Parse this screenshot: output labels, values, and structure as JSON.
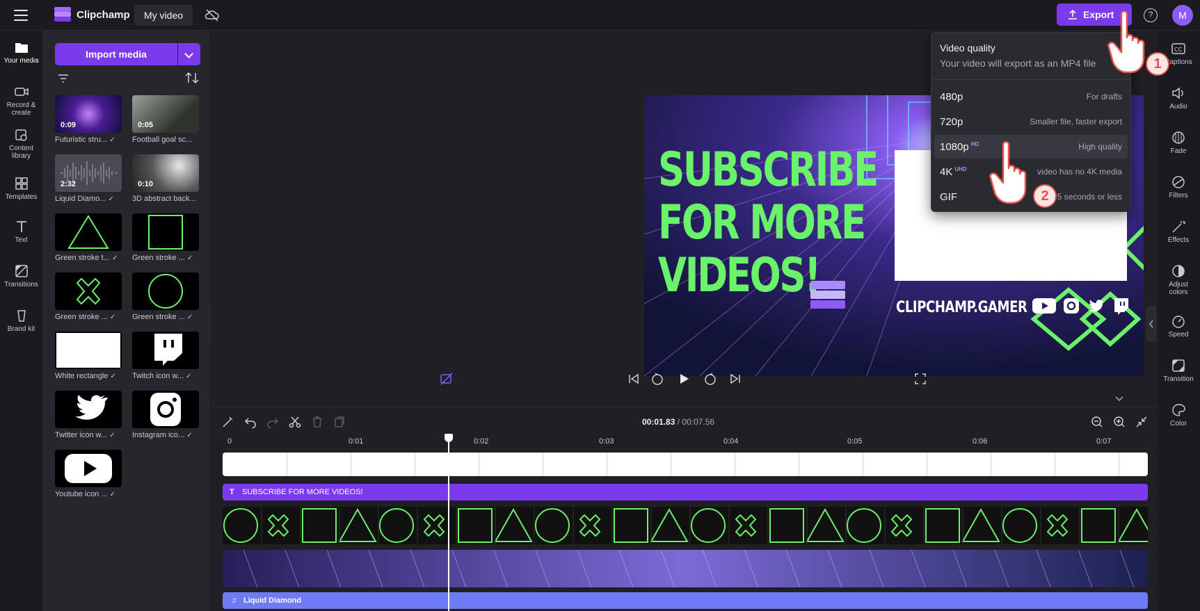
{
  "topbar": {
    "app_name": "Clipchamp",
    "project_name": "My video",
    "export_label": "Export",
    "avatar_initial": "M"
  },
  "left_rail": {
    "items": [
      {
        "label": "Your media",
        "icon": "folder-icon"
      },
      {
        "label": "Record & create",
        "icon": "camera-icon"
      },
      {
        "label": "Content library",
        "icon": "library-icon"
      },
      {
        "label": "Templates",
        "icon": "templates-icon"
      },
      {
        "label": "Text",
        "icon": "text-icon"
      },
      {
        "label": "Transitions",
        "icon": "transitions-icon"
      },
      {
        "label": "Brand kit",
        "icon": "brand-kit-icon"
      }
    ]
  },
  "media": {
    "import_label": "Import media",
    "items": [
      {
        "label": "Futuristic stru...",
        "duration": "0:09",
        "checked": true
      },
      {
        "label": "Football goal sc...",
        "duration": "0:05",
        "checked": false
      },
      {
        "label": "Liquid Diamo...",
        "duration": "2:32",
        "checked": true
      },
      {
        "label": "3D abstract back...",
        "duration": "0:10",
        "checked": false
      },
      {
        "label": "Green stroke t...",
        "duration": "",
        "checked": true
      },
      {
        "label": "Green stroke ...",
        "duration": "",
        "checked": true
      },
      {
        "label": "Green stroke ...",
        "duration": "",
        "checked": true
      },
      {
        "label": "Green stroke ...",
        "duration": "",
        "checked": true
      },
      {
        "label": "White rectangle",
        "duration": "",
        "checked": true
      },
      {
        "label": "Twitch icon w...",
        "duration": "",
        "checked": true
      },
      {
        "label": "Twitter icon w...",
        "duration": "",
        "checked": true
      },
      {
        "label": "Instagram ico...",
        "duration": "",
        "checked": true
      },
      {
        "label": "Youtube icon ...",
        "duration": "",
        "checked": true
      }
    ]
  },
  "preview": {
    "title_line1": "SUBSCRIBE",
    "title_line2": "FOR MORE",
    "title_line3": "VIDEOS!",
    "handle": "CLIPCHAMP.GAMER"
  },
  "quality_menu": {
    "title": "Video quality",
    "subtitle": "Your video will export as an MP4 file",
    "options": [
      {
        "res": "480p",
        "badge": "",
        "note": "For drafts"
      },
      {
        "res": "720p",
        "badge": "",
        "note": "Smaller file, faster export"
      },
      {
        "res": "1080p",
        "badge": "HD",
        "note": "High quality"
      },
      {
        "res": "4K",
        "badge": "UHD",
        "note": "video has no 4K media"
      },
      {
        "res": "GIF",
        "badge": "",
        "note": "5 seconds or less"
      }
    ],
    "steps": [
      "1",
      "2"
    ]
  },
  "right_rail": {
    "items": [
      {
        "label": "Captions",
        "icon": "captions-icon"
      },
      {
        "label": "Audio",
        "icon": "audio-icon"
      },
      {
        "label": "Fade",
        "icon": "fade-icon"
      },
      {
        "label": "Filters",
        "icon": "filters-icon"
      },
      {
        "label": "Effects",
        "icon": "effects-icon"
      },
      {
        "label": "Adjust colors",
        "icon": "adjust-colors-icon"
      },
      {
        "label": "Speed",
        "icon": "speed-icon"
      },
      {
        "label": "Transition",
        "icon": "transition-icon"
      },
      {
        "label": "Color",
        "icon": "color-icon"
      }
    ]
  },
  "timeline": {
    "current_time": "00:01.83",
    "total_time": "/ 00:07.56",
    "ruler": [
      "0",
      "0:01",
      "0:02",
      "0:03",
      "0:04",
      "0:05",
      "0:06",
      "0:07"
    ],
    "text_clip": "SUBSCRIBE FOR MORE VIDEOS!",
    "audio_clip": "Liquid Diamond"
  },
  "colors": {
    "accent": "#7c3aed",
    "green_stroke": "#6af26a",
    "background": "#1f1f24"
  }
}
